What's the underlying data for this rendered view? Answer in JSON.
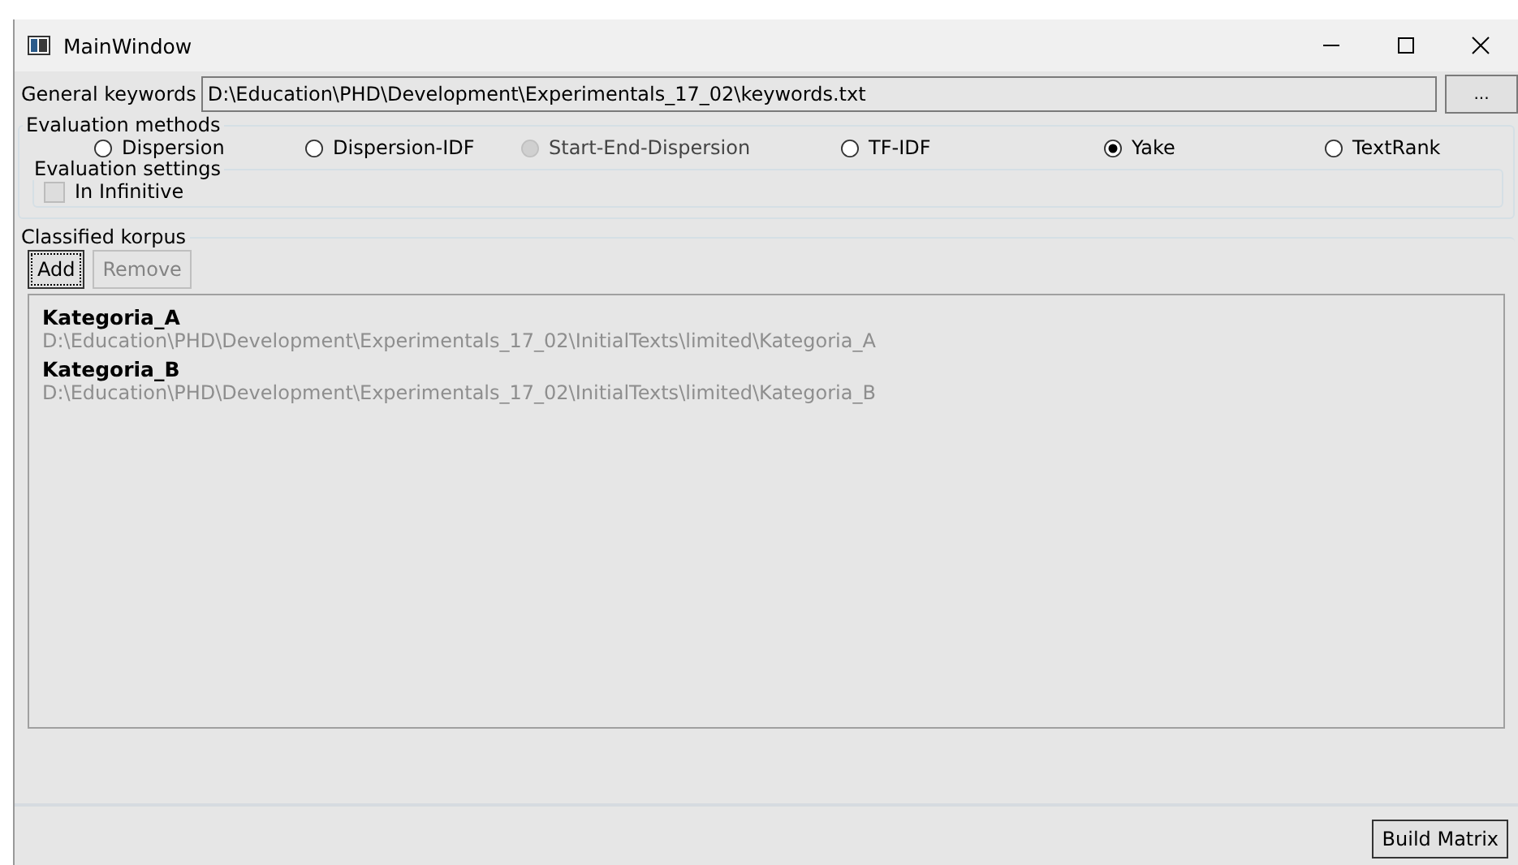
{
  "window": {
    "title": "MainWindow"
  },
  "general_keywords": {
    "label": "General keywords",
    "value": "D:\\Education\\PHD\\Development\\Experimentals_17_02\\keywords.txt",
    "browse_button": "..."
  },
  "evaluation_methods": {
    "title": "Evaluation methods",
    "options": [
      {
        "label": "Dispersion",
        "selected": false,
        "disabled": false
      },
      {
        "label": "Dispersion-IDF",
        "selected": false,
        "disabled": false
      },
      {
        "label": "Start-End-Dispersion",
        "selected": false,
        "disabled": true
      },
      {
        "label": "TF-IDF",
        "selected": false,
        "disabled": false
      },
      {
        "label": "Yake",
        "selected": true,
        "disabled": false
      },
      {
        "label": "TextRank",
        "selected": false,
        "disabled": false
      }
    ]
  },
  "evaluation_settings": {
    "title": "Evaluation settings",
    "options": [
      {
        "label": "In Infinitive",
        "checked": false
      }
    ]
  },
  "classified_korpus": {
    "title": "Classified korpus",
    "buttons": [
      {
        "label": "Add",
        "disabled": false,
        "focused": true
      },
      {
        "label": "Remove",
        "disabled": true,
        "focused": false
      }
    ],
    "items": [
      {
        "name": "Kategoria_A",
        "path": "D:\\Education\\PHD\\Development\\Experimentals_17_02\\InitialTexts\\limited\\Kategoria_A"
      },
      {
        "name": "Kategoria_B",
        "path": "D:\\Education\\PHD\\Development\\Experimentals_17_02\\InitialTexts\\limited\\Kategoria_B"
      }
    ]
  },
  "footer_button": "Build Matrix"
}
